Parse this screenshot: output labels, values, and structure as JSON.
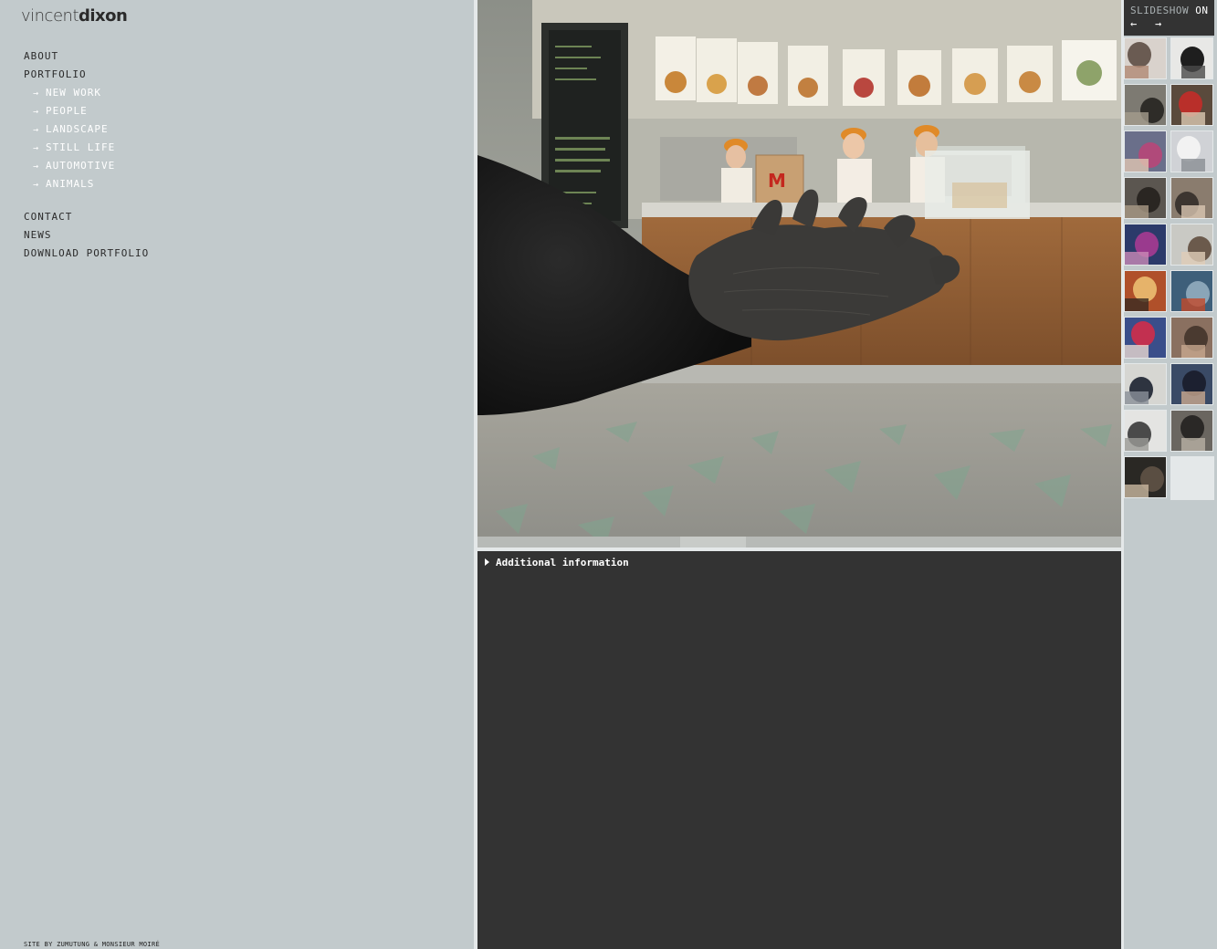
{
  "logo": {
    "light": "vincent",
    "bold": "dixon"
  },
  "nav": {
    "about": "ABOUT",
    "portfolio": "PORTFOLIO",
    "sub": [
      {
        "label": "NEW WORK"
      },
      {
        "label": "PEOPLE"
      },
      {
        "label": "LANDSCAPE"
      },
      {
        "label": "STILL LIFE"
      },
      {
        "label": "AUTOMOTIVE"
      },
      {
        "label": "ANIMALS"
      }
    ],
    "contact": "CONTACT",
    "news": "NEWS",
    "download": "DOWNLOAD PORTFOLIO"
  },
  "credit": "SITE BY ZUMUTUNG & MONSIEUR MOIRÉ",
  "slideshow": {
    "label": "SLIDESHOW",
    "state": "ON",
    "prev": "←",
    "next": "→"
  },
  "info": {
    "toggle": "Additional information"
  },
  "colors": {
    "panel": "#c2cacc",
    "dark": "#333333",
    "divider": "#e4e8e9"
  },
  "thumbnails": [
    {
      "subject": "sleeping figure"
    },
    {
      "subject": "dark figure"
    },
    {
      "subject": "interior scene"
    },
    {
      "subject": "red car"
    },
    {
      "subject": "group portrait"
    },
    {
      "subject": "white product"
    },
    {
      "subject": "chimpanzee"
    },
    {
      "subject": "creature face"
    },
    {
      "subject": "purple bird"
    },
    {
      "subject": "couple"
    },
    {
      "subject": "warrior"
    },
    {
      "subject": "boats at sea"
    },
    {
      "subject": "red costume"
    },
    {
      "subject": "hand close-up"
    },
    {
      "subject": "businessmen"
    },
    {
      "subject": "man in suit"
    },
    {
      "subject": "street runner"
    },
    {
      "subject": "smashed face"
    },
    {
      "subject": "man seated"
    }
  ]
}
